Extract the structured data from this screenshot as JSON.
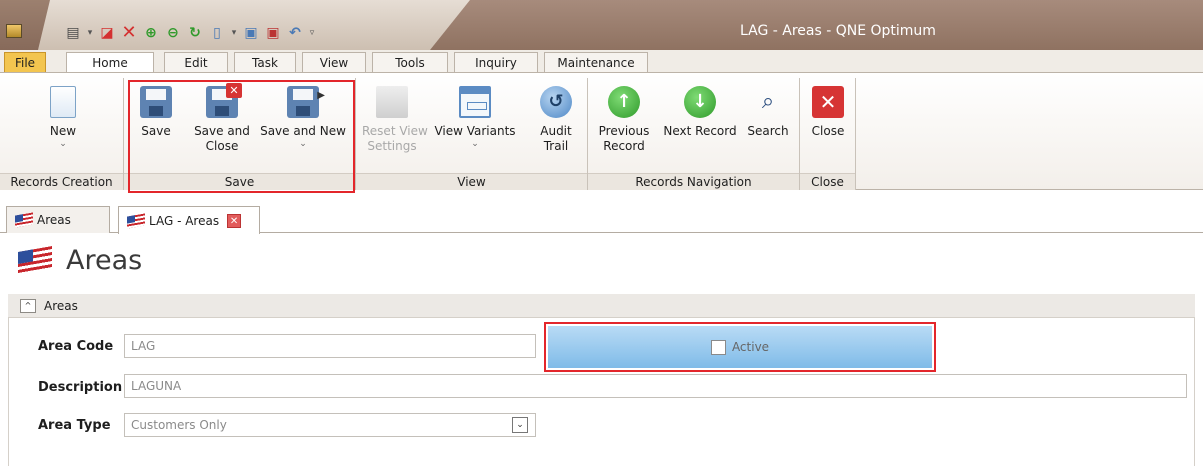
{
  "window": {
    "title": "LAG - Areas - QNE Optimum"
  },
  "quick_access": {
    "icons": [
      "notes-icon",
      "dropdown-arrow-icon",
      "delete-icon",
      "close-icon",
      "up-icon",
      "down-icon",
      "refresh-icon",
      "new-icon",
      "dropdown-arrow-icon",
      "save-icon",
      "save-close-icon",
      "undo-icon",
      "customize-icon"
    ]
  },
  "ribbon_tabs": [
    {
      "label": "File"
    },
    {
      "label": "Home"
    },
    {
      "label": "Edit"
    },
    {
      "label": "Task"
    },
    {
      "label": "View"
    },
    {
      "label": "Tools"
    },
    {
      "label": "Inquiry"
    },
    {
      "label": "Maintenance"
    }
  ],
  "ribbon": {
    "groups": {
      "records_creation": "Records Creation",
      "save": "Save",
      "view": "View",
      "records_navigation": "Records Navigation",
      "close": "Close"
    },
    "buttons": {
      "new": "New",
      "save": "Save",
      "save_and_close_1": "Save and",
      "save_and_close_2": "Close",
      "save_and_new": "Save and New",
      "reset_view_1": "Reset View",
      "reset_view_2": "Settings",
      "view_variants": "View Variants",
      "audit_1": "Audit",
      "audit_2": "Trail",
      "previous_1": "Previous",
      "previous_2": "Record",
      "next_record": "Next Record",
      "search": "Search",
      "close": "Close"
    }
  },
  "doc_tabs": [
    {
      "label": "Areas"
    },
    {
      "label": "LAG - Areas"
    }
  ],
  "page": {
    "title": "Areas",
    "section_title": "Areas"
  },
  "form": {
    "area_code": {
      "label": "Area Code",
      "value": "LAG"
    },
    "active": {
      "label": "Active",
      "checked": false
    },
    "description": {
      "label": "Description",
      "value": "LAGUNA"
    },
    "area_type": {
      "label": "Area Type",
      "value": "Customers Only"
    }
  },
  "colors": {
    "title_bar": "#8f7261",
    "file_tab": "#f3c54f",
    "highlight": "#e3262b",
    "active_zone": "#7fbbe8"
  }
}
